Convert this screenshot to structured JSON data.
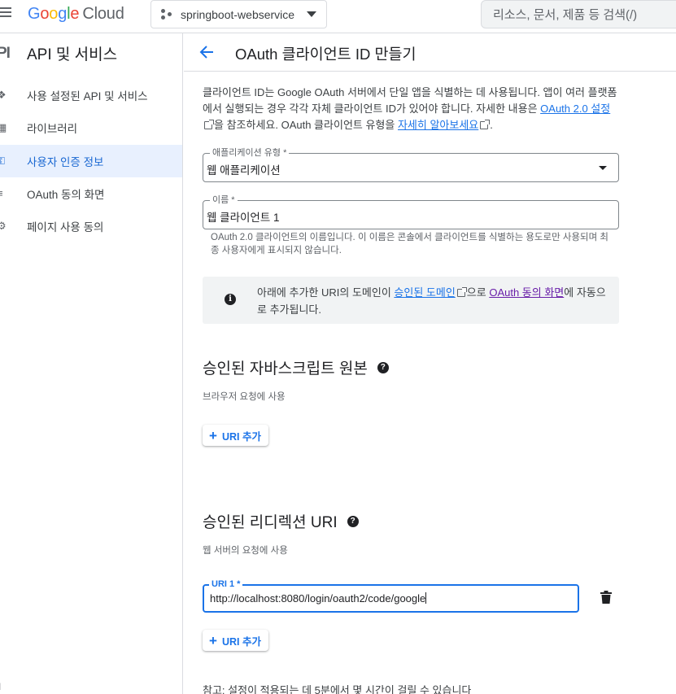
{
  "topbar": {
    "logo_letters": [
      "G",
      "o",
      "o",
      "g",
      "l",
      "e"
    ],
    "logo_product": "Cloud",
    "project_name": "springboot-webservice",
    "search_placeholder": "리소스, 문서, 제품 등 검색(/)"
  },
  "sidebar": {
    "icon_text": "PI",
    "title": "API 및 서비스",
    "items": [
      {
        "label": "사용 설정된 API 및 서비스",
        "icon": "enabled-apis-icon",
        "active": false
      },
      {
        "label": "라이브러리",
        "icon": "library-icon",
        "active": false
      },
      {
        "label": "사용자 인증 정보",
        "icon": "key-icon",
        "active": true
      },
      {
        "label": "OAuth 동의 화면",
        "icon": "consent-icon",
        "active": false
      },
      {
        "label": "페이지 사용 동의",
        "icon": "settings-icon",
        "active": false
      }
    ],
    "bottom_text": "I"
  },
  "header": {
    "title": "OAuth 클라이언트 ID 만들기"
  },
  "intro": {
    "text_1": "클라이언트 ID는 Google OAuth 서버에서 단일 앱을 식별하는 데 사용됩니다. 앱이 여러 플랫폼에서 실행되는 경우 각각 자체 클라이언트 ID가 있어야 합니다. 자세한 내용은 ",
    "link_1": "OAuth 2.0 설정",
    "text_2": "을 참조하세요. OAuth 클라이언트 유형을 ",
    "link_2": "자세히 알아보세요",
    "text_3": "."
  },
  "app_type": {
    "label": "애플리케이션 유형 *",
    "value": "웹 애플리케이션"
  },
  "name_field": {
    "label": "이름 *",
    "value": "웹 클라이언트 1",
    "hint": "OAuth 2.0 클라이언트의 이름입니다. 이 이름은 콘솔에서 클라이언트를 식별하는 용도로만 사용되며 최종 사용자에게 표시되지 않습니다."
  },
  "info_box": {
    "text_1": "아래에 추가한 URI의 도메인이 ",
    "link_1": "승인된 도메인",
    "text_2": "으로 ",
    "link_2": "OAuth 동의 화면",
    "text_3": "에 자동으로 추가됩니다."
  },
  "js_origins": {
    "title": "승인된 자바스크립트 원본",
    "subtitle": "브라우저 요청에 사용",
    "add_button": "URI 추가"
  },
  "redirect_uris": {
    "title": "승인된 리디렉션 URI",
    "subtitle": "웹 서버의 요청에 사용",
    "uri_label": "URI 1 *",
    "uri_value": "http://localhost:8080/login/oauth2/code/google",
    "add_button": "URI 추가"
  },
  "note": "참고: 설정이 적용되는 데 5분에서 몇 시간이 걸릴 수 있습니다",
  "colors": {
    "accent": "#1a73e8",
    "active_bg": "#e8f0fe",
    "active_text": "#1967d2",
    "visited_link": "#681da8"
  }
}
